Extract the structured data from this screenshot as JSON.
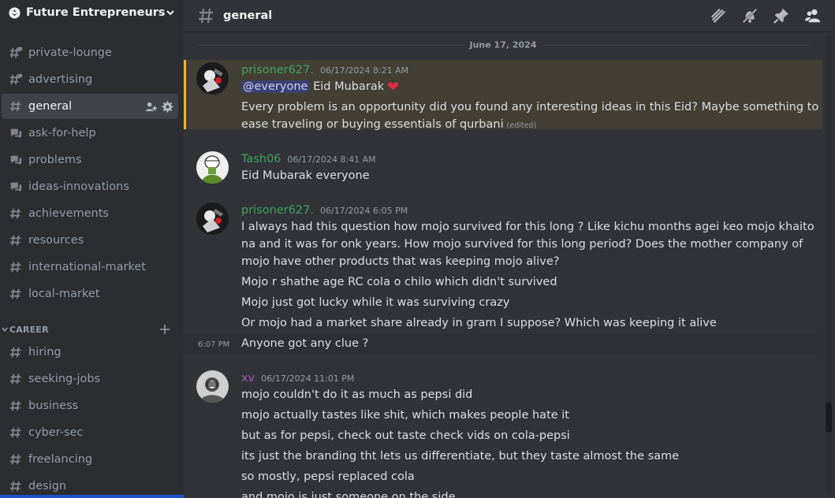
{
  "server": {
    "name": "Future Entrepreneurs..."
  },
  "sidebar": {
    "channels": [
      {
        "label": "private-lounge",
        "icon": "hash-lock-icon"
      },
      {
        "label": "advertising",
        "icon": "hash-lock-icon"
      },
      {
        "label": "general",
        "icon": "hash-icon",
        "active": true
      },
      {
        "label": "ask-for-help",
        "icon": "forum-icon"
      },
      {
        "label": "problems",
        "icon": "forum-icon"
      },
      {
        "label": "ideas-innovations",
        "icon": "forum-icon"
      },
      {
        "label": "achievements",
        "icon": "hash-icon"
      },
      {
        "label": "resources",
        "icon": "hash-icon"
      },
      {
        "label": "international-market",
        "icon": "hash-icon"
      },
      {
        "label": "local-market",
        "icon": "hash-icon"
      }
    ],
    "category": "CAREER",
    "career_channels": [
      {
        "label": "hiring",
        "icon": "hash-icon"
      },
      {
        "label": "seeking-jobs",
        "icon": "hash-icon"
      },
      {
        "label": "business",
        "icon": "hash-icon"
      },
      {
        "label": "cyber-sec",
        "icon": "hash-icon"
      },
      {
        "label": "freelancing",
        "icon": "hash-icon"
      },
      {
        "label": "design",
        "icon": "hash-icon"
      }
    ]
  },
  "header": {
    "channel": "general"
  },
  "date_divider": "June 17, 2024",
  "messages": [
    {
      "author": "prisoner627.",
      "author_color": "#3ba55c",
      "timestamp": "06/17/2024 8:21 AM",
      "mention": "@everyone",
      "first_line_text": "Eid Mubarak",
      "lines": [
        "Every problem is an opportunity did you found any interesting ideas in this Eid? Maybe something to",
        "ease traveling or buying essentials of qurbani"
      ],
      "edited": "(edited)"
    },
    {
      "author": "Tash06",
      "author_color": "#3ba55c",
      "timestamp": "06/17/2024 8:41 AM",
      "lines": [
        "Eid Mubarak everyone"
      ]
    },
    {
      "author": "prisoner627.",
      "author_color": "#3ba55c",
      "timestamp": "06/17/2024 6:05 PM",
      "lines": [
        "I always had this question how mojo survived for this long ? Like kichu months agei keo mojo khaito",
        "na and it was for onk years. How mojo survived for this long period? Does the mother company of",
        "mojo have other products that was keeping mojo alive?",
        "Mojo r shathe age RC cola o chilo which didn't survived",
        "Mojo just got lucky while it was surviving crazy",
        "Or mojo had a market share already in gram I suppose? Which was keeping it alive"
      ],
      "followup_time": "6:07 PM",
      "followup": "Anyone got any clue ?"
    },
    {
      "author": "xv",
      "author_color": "#9b59b6",
      "timestamp": "06/17/2024 11:01 PM",
      "lines": [
        "mojo couldn't do it as much as pepsi did",
        "mojo actually tastes like shit, which makes people hate it",
        "but as for pepsi, check out taste check vids on cola-pepsi",
        "its just the branding tht lets us differentiate, but they taste almost the same",
        "so mostly, pepsi replaced cola",
        "and mojo is just someone on the side"
      ]
    }
  ]
}
